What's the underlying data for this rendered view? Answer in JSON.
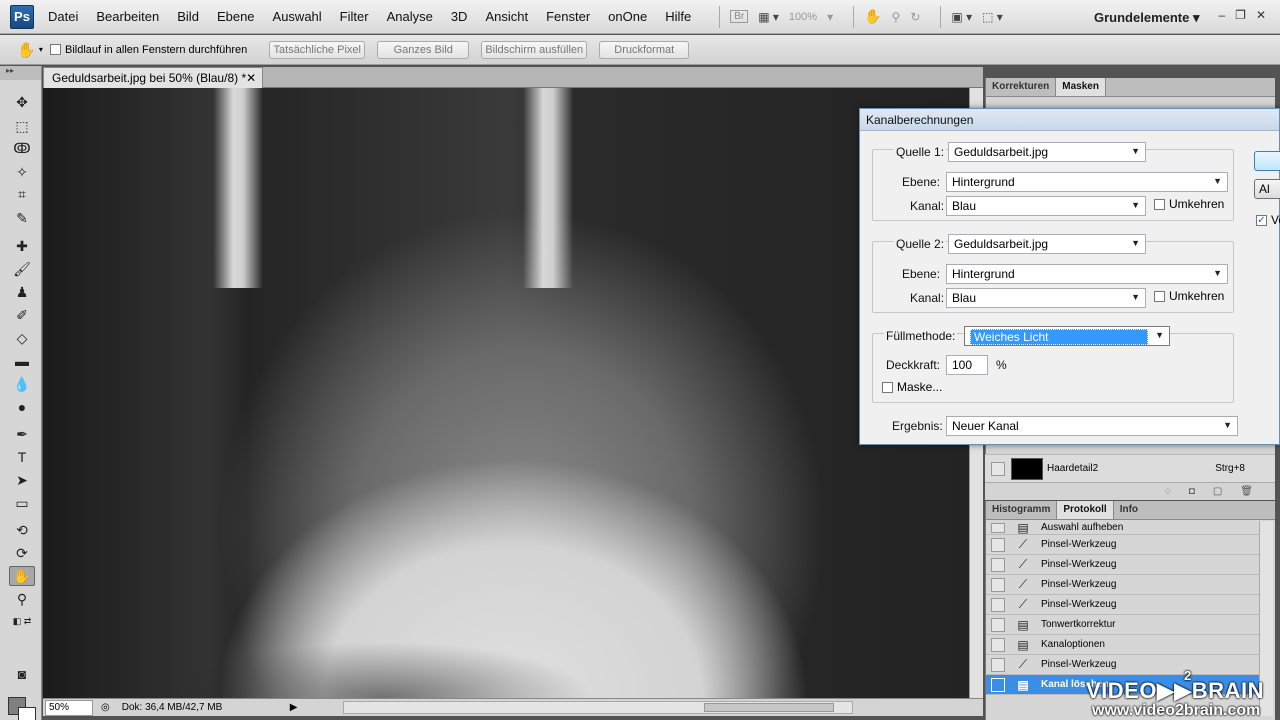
{
  "menubar": {
    "logo": "Ps",
    "items": [
      "Datei",
      "Bearbeiten",
      "Bild",
      "Ebene",
      "Auswahl",
      "Filter",
      "Analyse",
      "3D",
      "Ansicht",
      "Fenster",
      "onOne",
      "Hilfe"
    ],
    "bridge_label": "Br",
    "zoom_label": "100%",
    "workspace": "Grundelemente",
    "icons": [
      "bridge-icon",
      "minibridge-icon",
      "hand-icon",
      "zoom-icon",
      "rotate-icon",
      "arrange-icon",
      "screenmode-icon"
    ]
  },
  "options": {
    "checkbox_label": "Bildlauf in allen Fenstern durchführen",
    "buttons": [
      "Tatsächliche Pixel",
      "Ganzes Bild",
      "Bildschirm ausfüllen",
      "Druckformat"
    ]
  },
  "document": {
    "tab_title": "Geduldsarbeit.jpg bei 50% (Blau/8) *",
    "tab_close": "✕",
    "zoom": "50%",
    "doc_info": "Dok: 36,4 MB/42,7 MB"
  },
  "panels": {
    "top_tabs": [
      "Korrekturen",
      "Masken"
    ],
    "channel_name": "Haardetail2",
    "channel_shortcut": "Strg+8",
    "history_tabs": [
      "Histogramm",
      "Protokoll",
      "Info"
    ],
    "history_items": [
      {
        "label": "Auswahl aufheben",
        "icon": "document-icon"
      },
      {
        "label": "Pinsel-Werkzeug",
        "icon": "brush-icon"
      },
      {
        "label": "Pinsel-Werkzeug",
        "icon": "brush-icon"
      },
      {
        "label": "Pinsel-Werkzeug",
        "icon": "brush-icon"
      },
      {
        "label": "Pinsel-Werkzeug",
        "icon": "brush-icon"
      },
      {
        "label": "Tonwertkorrektur",
        "icon": "document-icon"
      },
      {
        "label": "Kanaloptionen",
        "icon": "document-icon"
      },
      {
        "label": "Pinsel-Werkzeug",
        "icon": "brush-icon"
      },
      {
        "label": "Kanal löschen",
        "icon": "document-icon",
        "selected": true
      }
    ]
  },
  "dialog": {
    "title": "Kanalberechnungen",
    "source1": {
      "label": "Quelle 1:",
      "file": "Geduldsarbeit.jpg",
      "layer_label": "Ebene:",
      "layer": "Hintergrund",
      "channel_label": "Kanal:",
      "channel": "Blau",
      "invert_label": "Umkehren"
    },
    "source2": {
      "label": "Quelle 2:",
      "file": "Geduldsarbeit.jpg",
      "layer_label": "Ebene:",
      "layer": "Hintergrund",
      "channel_label": "Kanal:",
      "channel": "Blau",
      "invert_label": "Umkehren"
    },
    "blend_label": "Füllmethode:",
    "blend_value": "Weiches Licht",
    "opacity_label": "Deckkraft:",
    "opacity_value": "100",
    "opacity_unit": "%",
    "mask_label": "Maske...",
    "result_label": "Ergebnis:",
    "result_value": "Neuer Kanal",
    "side_button_2": "Al",
    "preview_label": "Vo",
    "preview_checked": true
  },
  "watermark": {
    "brand": "VIDEO▶▶BRAIN",
    "superscript": "2",
    "url": "www.video2brain.com"
  }
}
